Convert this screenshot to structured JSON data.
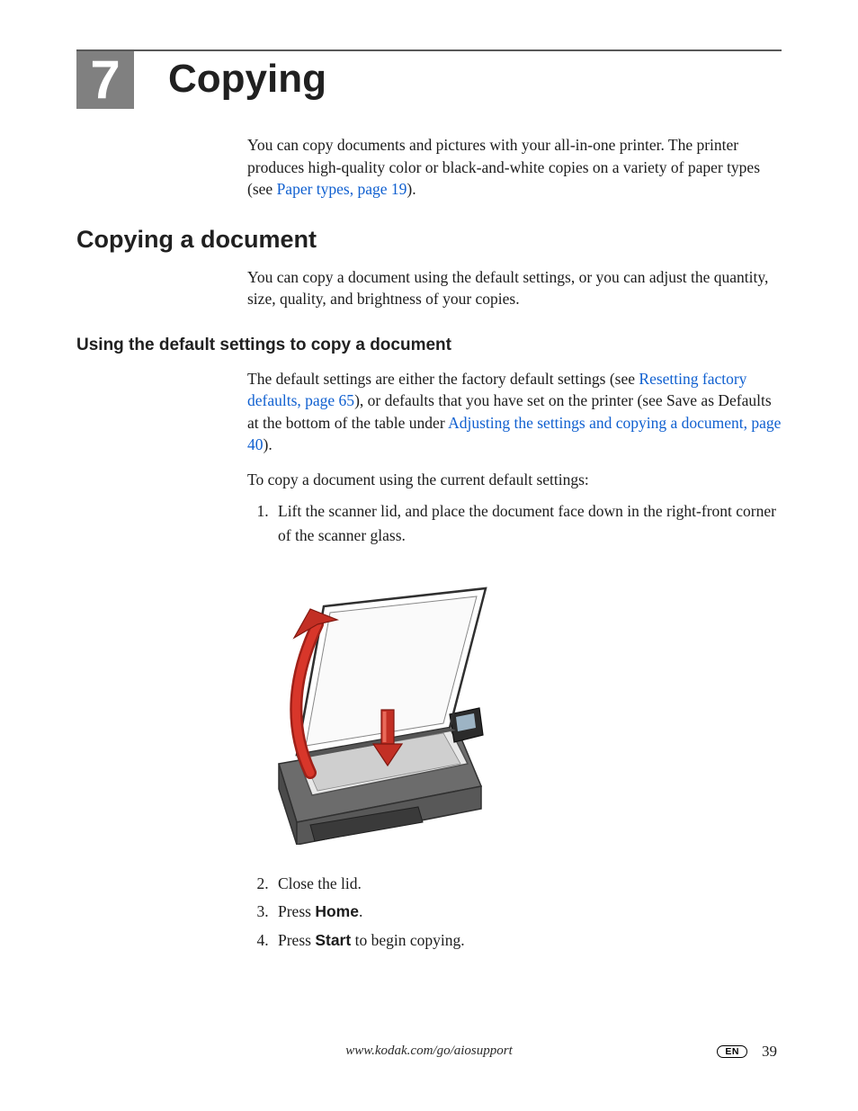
{
  "chapter": {
    "number": "7",
    "title": "Copying"
  },
  "intro": {
    "p1a": "You can copy documents and pictures with your all-in-one printer. The printer produces high-quality color or black-and-white copies on a variety of paper types (see ",
    "link1": "Paper types, page 19",
    "p1b": ")."
  },
  "section1": {
    "heading": "Copying a document",
    "p1": "You can copy a document using the default settings, or you can adjust the quantity, size, quality, and brightness of your copies."
  },
  "section2": {
    "heading": "Using the default settings to copy a document",
    "p1a": "The default settings are either the factory default settings (see ",
    "link1": "Resetting factory defaults, page 65",
    "p1b": "), or defaults that you have set on the printer (see Save as Defaults at the bottom of the table under ",
    "link2": "Adjusting the settings and copying a document, page 40",
    "p1c": ").",
    "p2": "To copy a document using the current default settings:"
  },
  "steps": {
    "s1": "Lift the scanner lid, and place the document face down in the right-front corner of the scanner glass.",
    "s2": "Close the lid.",
    "s3a": "Press ",
    "s3b": "Home",
    "s3c": ".",
    "s4a": "Press ",
    "s4b": "Start",
    "s4c": " to begin copying."
  },
  "footer": {
    "url": "www.kodak.com/go/aiosupport",
    "lang": "EN",
    "pagenum": "39"
  }
}
